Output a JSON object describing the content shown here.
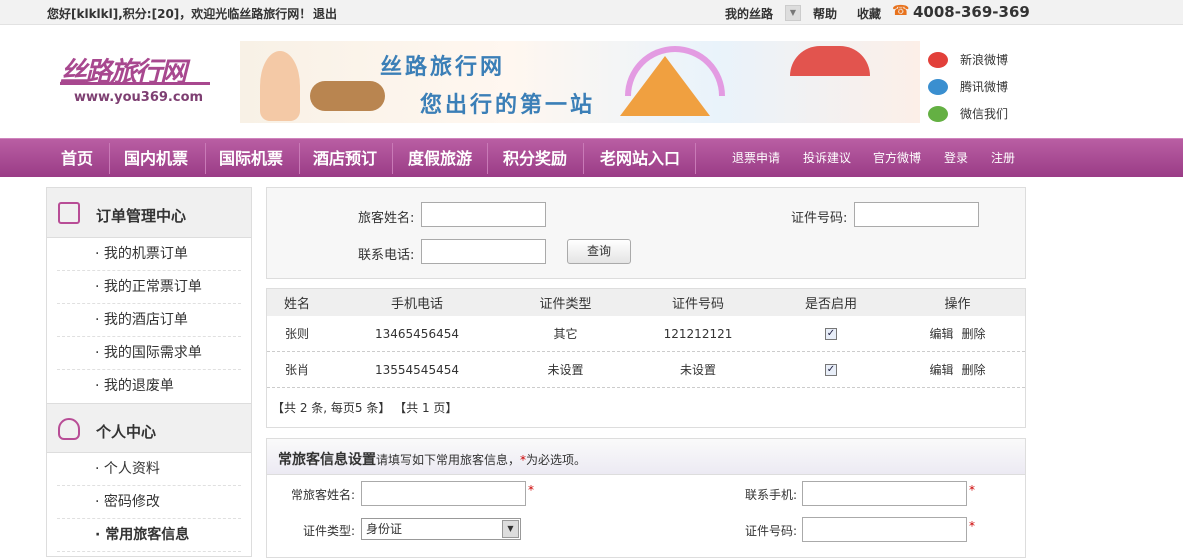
{
  "topbar": {
    "welcome": "您好[klklkl],积分:[20]，欢迎光临丝路旅行网！",
    "logout": "退出",
    "my_silkroad": "我的丝路",
    "help": "帮助",
    "favorite": "收藏",
    "phone": "4008-369-369"
  },
  "header": {
    "logo_text": "丝路旅行网",
    "logo_url": "www.you369.com",
    "banner_title": "丝路旅行网",
    "banner_slogan": "您出行的第一站",
    "social": [
      {
        "label": "新浪微博",
        "icon": "weibo-icon"
      },
      {
        "label": "腾讯微博",
        "icon": "tencent-weibo-icon"
      },
      {
        "label": "微信我们",
        "icon": "wechat-icon"
      }
    ]
  },
  "nav": {
    "main": [
      "首页",
      "国内机票",
      "国际机票",
      "酒店预订",
      "度假旅游",
      "积分奖励",
      "老网站入口"
    ],
    "secondary": [
      "退票申请",
      "投诉建议",
      "官方微博",
      "登录",
      "注册"
    ]
  },
  "sidebar": {
    "order_center": {
      "title": "订单管理中心",
      "items": [
        "· 我的机票订单",
        "· 我的正常票订单",
        "· 我的酒店订单",
        "· 我的国际需求单",
        "· 我的退废单"
      ]
    },
    "personal_center": {
      "title": "个人中心",
      "items": [
        "· 个人资料",
        "· 密码修改",
        "· 常用旅客信息"
      ]
    }
  },
  "search": {
    "name_label": "旅客姓名:",
    "id_label": "证件号码:",
    "phone_label": "联系电话:",
    "query_button": "查询"
  },
  "table": {
    "headers": [
      "姓名",
      "手机电话",
      "证件类型",
      "证件号码",
      "是否启用",
      "操作"
    ],
    "rows": [
      {
        "name": "张则",
        "phone": "13465456454",
        "id_type": "其它",
        "id_no": "121212121",
        "enabled": "✓",
        "edit": "编辑",
        "delete": "删除"
      },
      {
        "name": "张肖",
        "phone": "13554545454",
        "id_type": "未设置",
        "id_no": "未设置",
        "enabled": "✓",
        "edit": "编辑",
        "delete": "删除"
      }
    ],
    "pager": "【共 2 条, 每页5 条】 【共 1 页】"
  },
  "form": {
    "title": "常旅客信息设置",
    "subtitle": "请填写如下常用旅客信息，",
    "required_note_star": "*",
    "required_note": "为必选项。",
    "name_label": "常旅客姓名:",
    "mobile_label": "联系手机:",
    "id_type_label": "证件类型:",
    "id_type_value": "身份证",
    "id_no_label": "证件号码:",
    "star": "*"
  },
  "colors": {
    "nav_bg": "#a8488f",
    "accent": "#b84d96",
    "phone_icon": "#e8721c",
    "required": "#cc0000"
  }
}
